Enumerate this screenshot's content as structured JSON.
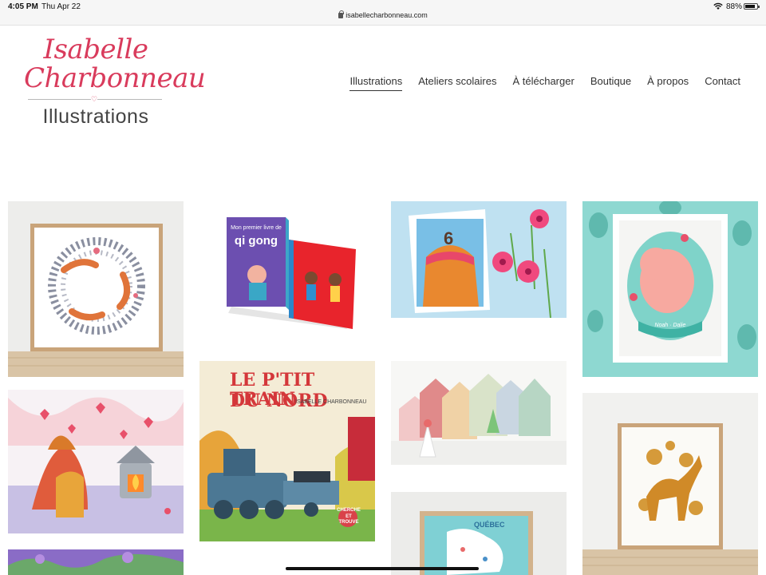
{
  "status_bar": {
    "time": "4:05 PM",
    "date": "Thu Apr 22",
    "url": "isabellecharbonneau.com",
    "battery": "88%",
    "battery_level": 0.88
  },
  "logo": {
    "line1": "Isabelle",
    "line2": "Charbonneau",
    "subtitle": "Illustrations",
    "color": "#d93b5c"
  },
  "nav": {
    "items": [
      {
        "label": "Illustrations",
        "active": true
      },
      {
        "label": "Ateliers scolaires"
      },
      {
        "label": "À télécharger"
      },
      {
        "label": "Boutique"
      },
      {
        "label": "À propos"
      },
      {
        "label": "Contact"
      }
    ]
  },
  "gallery": {
    "qigong_cover_title_small": "Mon premier livre de",
    "qigong_cover_title": "qi gong",
    "train_title_line1": "LE P'TIT TRAIN",
    "train_title_line2": "DU NORD",
    "train_author": "ISABELLE CHARBONNEAU",
    "train_badge_line1": "CHERCHE",
    "train_badge_line2": "ET TROUVE",
    "cake_number": "6",
    "map_title": "QUÉBEC",
    "baby_text": "Noah · Dalie"
  }
}
